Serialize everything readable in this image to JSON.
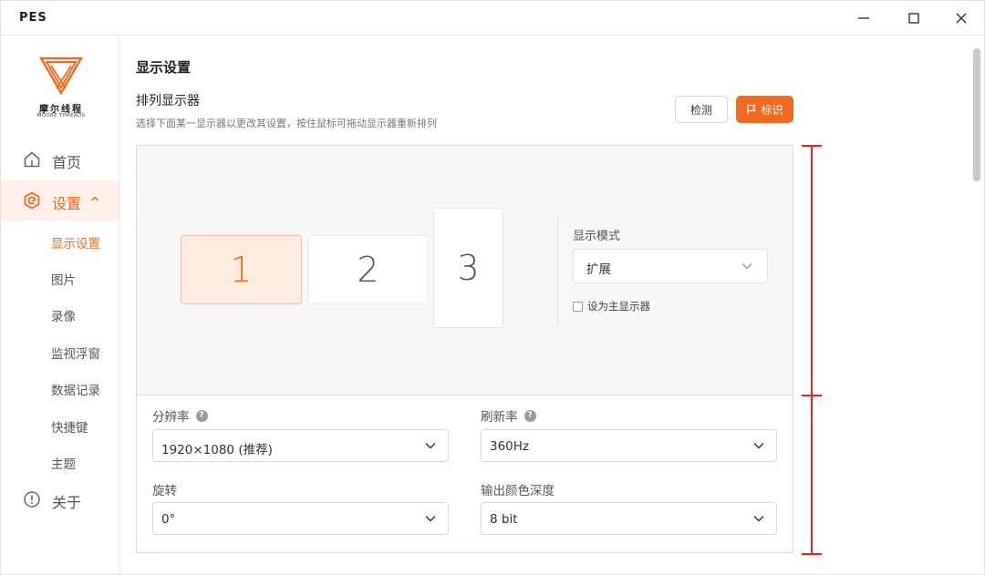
{
  "window": {
    "title": "PES",
    "minimize_icon": "minimize-icon",
    "maximize_icon": "maximize-icon",
    "close_icon": "close-icon"
  },
  "brand": {
    "name_cn": "摩尔线程",
    "name_en": "MOORE THREADS",
    "accent_color": "#f26a22"
  },
  "sidebar": {
    "home": {
      "label": "首页",
      "icon": "home-icon"
    },
    "settings": {
      "label": "设置",
      "icon": "settings-icon",
      "expanded": true
    },
    "sub_items": [
      {
        "label": "显示设置",
        "active": true
      },
      {
        "label": "图片",
        "active": false
      },
      {
        "label": "录像",
        "active": false
      },
      {
        "label": "监视浮窗",
        "active": false
      },
      {
        "label": "数据记录",
        "active": false
      },
      {
        "label": "快捷键",
        "active": false
      },
      {
        "label": "主题",
        "active": false
      }
    ],
    "about": {
      "label": "关于",
      "icon": "info-icon"
    }
  },
  "main": {
    "page_title": "显示设置",
    "section_title": "排列显示器",
    "section_desc": "选择下面某一显示器以更改其设置，按住鼠标可拖动显示器重新排列",
    "detect_label": "检测",
    "identify_label": "标识",
    "monitors": [
      "1",
      "2",
      "3"
    ],
    "selected_monitor": "1",
    "display_mode": {
      "label": "显示模式",
      "value": "扩展"
    },
    "set_primary": {
      "label": "设为主显示器",
      "checked": false
    },
    "resolution": {
      "label": "分辨率",
      "value": "1920×1080 (推荐)",
      "help": "?"
    },
    "refresh_rate": {
      "label": "刷新率",
      "value": "360Hz",
      "help": "?"
    },
    "rotation": {
      "label": "旋转",
      "value": "0°"
    },
    "color_depth": {
      "label": "输出颜色深度",
      "value": "8 bit"
    }
  }
}
